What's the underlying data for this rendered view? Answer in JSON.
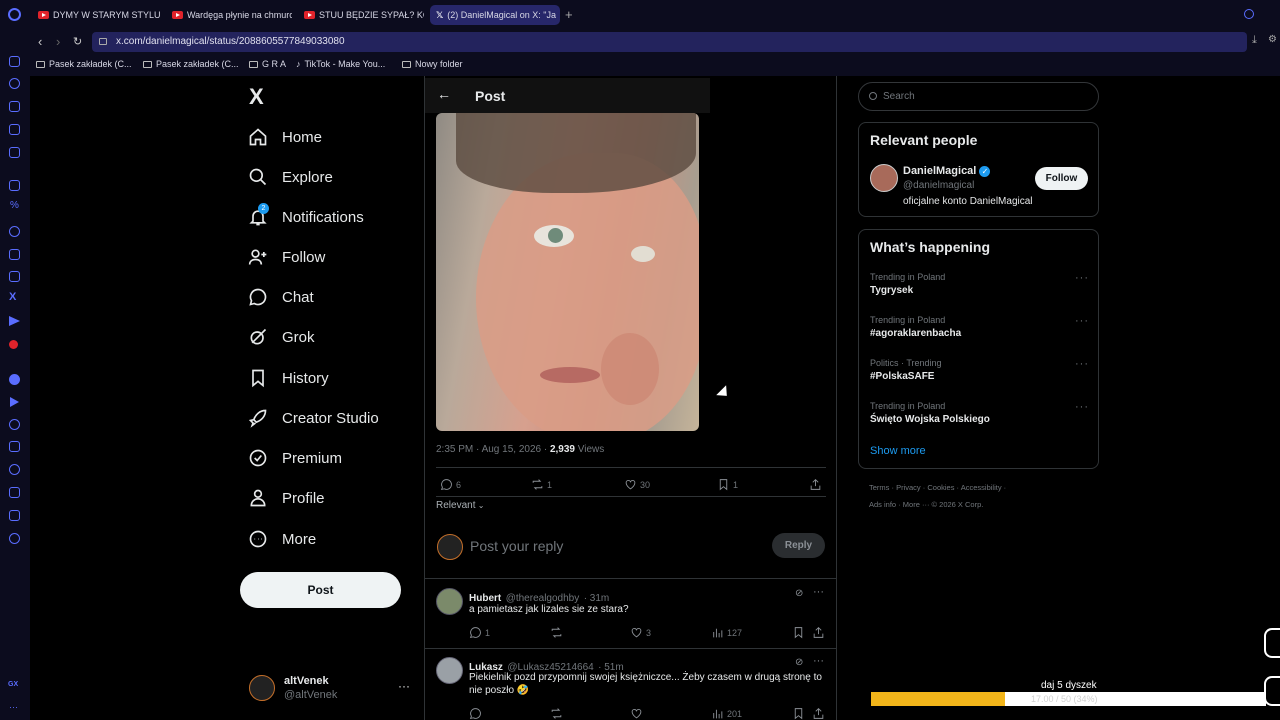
{
  "browser": {
    "tabs": [
      {
        "label": "DYMY W STARYM STYLU I",
        "active": false
      },
      {
        "label": "Wardęga płynie na chmurc",
        "active": false
      },
      {
        "label": "STUU BĘDZIE SYPAŁ? KON",
        "active": false
      },
      {
        "label": "(2) DanielMagical on X: \"Ja",
        "active": true
      }
    ],
    "url": "x.com/danielmagical/status/2088605577849033080",
    "bookmarks": [
      "Pasek zakładek (C...",
      "Pasek zakładek (C...",
      "G R A",
      "TikTok - Make You...",
      "Nowy folder"
    ]
  },
  "nav": {
    "logo": "X",
    "items": [
      {
        "label": "Home",
        "icon": "home-icon"
      },
      {
        "label": "Explore",
        "icon": "search-icon"
      },
      {
        "label": "Notifications",
        "icon": "bell-icon",
        "badge": "2"
      },
      {
        "label": "Follow",
        "icon": "person-plus-icon"
      },
      {
        "label": "Chat",
        "icon": "chat-icon"
      },
      {
        "label": "Grok",
        "icon": "grok-icon"
      },
      {
        "label": "History",
        "icon": "bookmark-icon"
      },
      {
        "label": "Creator Studio",
        "icon": "rocket-icon"
      },
      {
        "label": "Premium",
        "icon": "verified-icon"
      },
      {
        "label": "Profile",
        "icon": "person-icon"
      },
      {
        "label": "More",
        "icon": "more-circle-icon"
      }
    ],
    "post_button": "Post",
    "account": {
      "name": "altVenek",
      "handle": "@altVenek"
    }
  },
  "post": {
    "header_title": "Post",
    "timestamp": "2:35 PM · Aug 15, 2026 · ",
    "views": "2,939",
    "views_label": " Views",
    "stats": {
      "replies": "6",
      "reposts": "1",
      "likes": "30",
      "bookmarks": "1"
    },
    "sort_label": "Relevant",
    "reply_placeholder": "Post your reply",
    "reply_button": "Reply"
  },
  "replies": [
    {
      "name": "Hubert",
      "handle": "@therealgodhby",
      "time": "· 31m",
      "text": "a pamietasz jak lizales sie ze stara?",
      "replies": "1",
      "reposts": "",
      "likes": "3",
      "views": "127"
    },
    {
      "name": "Lukasz",
      "handle": "@Lukasz45214664",
      "time": "· 51m",
      "text": "Piekielnik pozd przypomnij swojej księżniczce... Żeby czasem w drugą stronę to nie poszło 🤣",
      "replies": "",
      "reposts": "",
      "likes": "",
      "views": "201"
    }
  ],
  "right": {
    "search_placeholder": "Search",
    "relevant_title": "Relevant people",
    "person": {
      "name": "DanielMagical",
      "handle": "@danielmagical",
      "bio": "oficjalne konto DanielMagical",
      "follow_label": "Follow"
    },
    "happening_title": "What’s happening",
    "trends": [
      {
        "context": "Trending in Poland",
        "topic": "Tygrysek"
      },
      {
        "context": "Trending in Poland",
        "topic": "#agoraklarenbacha"
      },
      {
        "context": "Politics · Trending",
        "topic": "#PolskaSAFE"
      },
      {
        "context": "Trending in Poland",
        "topic": "Święto Wojska Polskiego"
      }
    ],
    "show_more": "Show more",
    "footer_row1": [
      "Terms",
      "Privacy",
      "Cookies",
      "Accessibility"
    ],
    "footer_row2": [
      "Ads info",
      "More ···",
      "© 2026 X Corp."
    ]
  },
  "overlay": {
    "goal_label": "daj 5 dyszek",
    "goal_progress": "17.00 / 50 (34%)",
    "goal_fraction": 0.34
  },
  "colors": {
    "accent": "#1d9bf0",
    "progress": "#f2b51a",
    "browser": "#0c0c1e"
  }
}
